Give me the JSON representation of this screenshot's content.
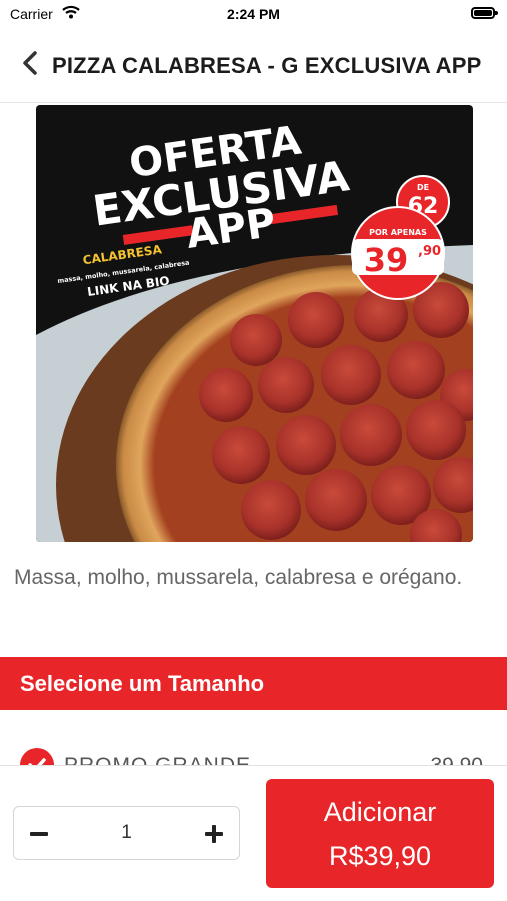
{
  "status_bar": {
    "carrier": "Carrier",
    "time": "2:24 PM"
  },
  "nav": {
    "title": "PIZZA CALABRESA - G EXCLUSIVA APP"
  },
  "product_image": {
    "headline_line1": "OFERTA",
    "headline_line2": "EXCLUSIVA",
    "headline_line3": "APP",
    "flavor": "CALABRESA",
    "ingredients": "massa, molho, mussarela, calabresa",
    "link_text": "LINK NA BIO",
    "old_price_label": "DE",
    "old_price": "62",
    "promo_label": "POR APENAS",
    "promo_price": "39",
    "promo_cents": ",90"
  },
  "product": {
    "description": "Massa, molho, mussarela, calabresa e orégano."
  },
  "size_section": {
    "header": "Selecione um Tamanho",
    "option_name": "PROMO GRANDE",
    "option_price": "39,90"
  },
  "bottom_bar": {
    "quantity": "1",
    "add_label": "Adicionar",
    "add_price": "R$39,90"
  },
  "colors": {
    "accent": "#e8262a",
    "image_bg": "#111111"
  },
  "icons": [
    "wifi-icon",
    "battery-icon",
    "back-chevron-icon",
    "check-icon",
    "minus-icon",
    "plus-icon"
  ]
}
